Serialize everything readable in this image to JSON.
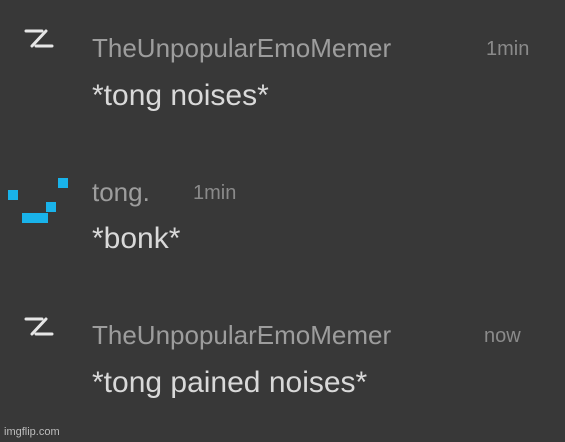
{
  "messages": [
    {
      "avatar_icon": "lightning-bolt-icon",
      "username": "TheUnpopularEmoMemer",
      "timestamp": "1min",
      "text": "*tong noises*"
    },
    {
      "avatar_icon": "pixel-smile-icon",
      "username": "tong.",
      "timestamp": "1min",
      "text": "*bonk*"
    },
    {
      "avatar_icon": "lightning-bolt-icon",
      "username": "TheUnpopularEmoMemer",
      "timestamp": "now",
      "text": "*tong pained noises*"
    }
  ],
  "watermark": "imgflip.com",
  "colors": {
    "background": "#383838",
    "username": "#9d9d9d",
    "message_text": "#d9d9d9",
    "tong_avatar": "#19b3ea"
  }
}
